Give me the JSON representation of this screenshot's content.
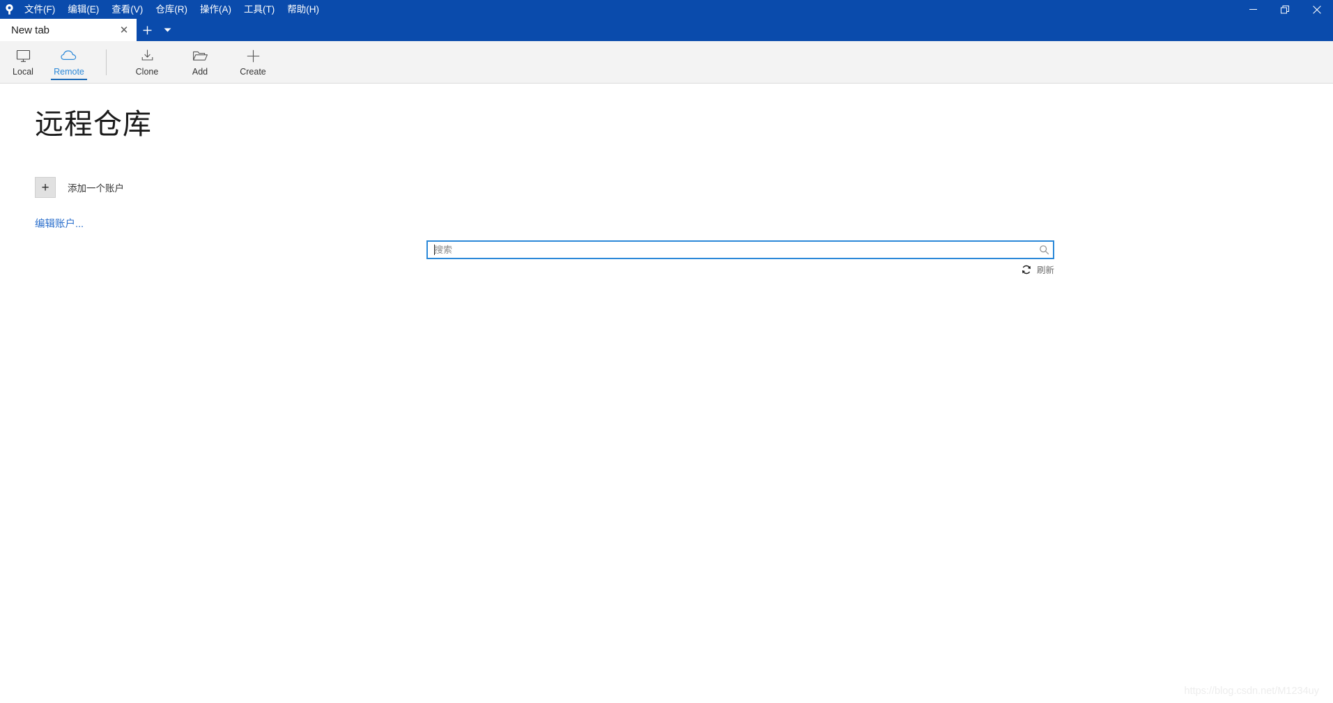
{
  "window": {
    "app_icon": "fork-app-icon",
    "menu": [
      {
        "label": "文件(F)",
        "name": "menu-file"
      },
      {
        "label": "编辑(E)",
        "name": "menu-edit"
      },
      {
        "label": "查看(V)",
        "name": "menu-view"
      },
      {
        "label": "仓库(R)",
        "name": "menu-repository"
      },
      {
        "label": "操作(A)",
        "name": "menu-actions"
      },
      {
        "label": "工具(T)",
        "name": "menu-tools"
      },
      {
        "label": "帮助(H)",
        "name": "menu-help"
      }
    ],
    "controls": {
      "minimize": "minimize-icon",
      "restore": "restore-icon",
      "close": "close-icon"
    },
    "accent_color": "#0a4bac"
  },
  "tabs": {
    "items": [
      {
        "title": "New tab",
        "active": true,
        "close_glyph": "✕"
      }
    ],
    "new_tab_glyph": "+",
    "tab_list_glyph": "▾"
  },
  "toolbar": {
    "left_group": [
      {
        "label": "Local",
        "icon": "monitor-icon",
        "active": false
      },
      {
        "label": "Remote",
        "icon": "cloud-icon",
        "active": true
      }
    ],
    "right_group": [
      {
        "label": "Clone",
        "icon": "clone-download-icon"
      },
      {
        "label": "Add",
        "icon": "folder-open-icon"
      },
      {
        "label": "Create",
        "icon": "plus-icon"
      }
    ],
    "active_color": "#2b88d8",
    "underline_color": "#1767b5"
  },
  "main": {
    "page_title": "远程仓库",
    "add_account": {
      "button_glyph": "+",
      "label": "添加一个账户"
    },
    "edit_account_link": "编辑账户...",
    "link_color": "#2b6fcc"
  },
  "search": {
    "value": "",
    "placeholder": "搜索",
    "icon": "search-icon",
    "focus_border_color": "#2b88d8"
  },
  "refresh": {
    "label": "刷新",
    "icon": "refresh-icon"
  },
  "watermark": {
    "text": "https://blog.csdn.net/M1234uy"
  }
}
